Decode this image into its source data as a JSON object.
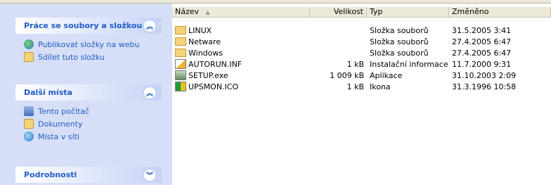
{
  "task_pane": {
    "sections": [
      {
        "title": "Práce se soubory a složkou",
        "toggle": "⌃",
        "items": [
          {
            "label": "Publikovat složky na webu",
            "icon": "globe-icon"
          },
          {
            "label": "Sdílet tuto složku",
            "icon": "share-folder-icon"
          }
        ]
      },
      {
        "title": "Další místa",
        "toggle": "⌃",
        "items": [
          {
            "label": "Tento počítač",
            "icon": "computer-icon"
          },
          {
            "label": "Dokumenty",
            "icon": "documents-folder-icon"
          },
          {
            "label": "Místa v síti",
            "icon": "network-places-icon"
          }
        ]
      },
      {
        "title": "Podrobnosti",
        "toggle": "⌄",
        "items": []
      }
    ]
  },
  "columns": {
    "name": "Název",
    "size": "Velikost",
    "type": "Typ",
    "modified": "Změněno",
    "sort_indicator": "▲"
  },
  "files": [
    {
      "name": "LINUX",
      "size": "",
      "type": "Složka souborů",
      "modified": "31.5.2005 3:41",
      "icon": "folder-icon"
    },
    {
      "name": "Netware",
      "size": "",
      "type": "Složka souborů",
      "modified": "27.4.2005 6:47",
      "icon": "folder-icon"
    },
    {
      "name": "Windows",
      "size": "",
      "type": "Složka souborů",
      "modified": "27.4.2005 6:47",
      "icon": "folder-icon"
    },
    {
      "name": "AUTORUN.INF",
      "size": "1 kB",
      "type": "Instalační informace",
      "modified": "11.7.2000 9:31",
      "icon": "setup-info-icon"
    },
    {
      "name": "SETUP.exe",
      "size": "1 009 kB",
      "type": "Aplikace",
      "modified": "31.10.2003 2:09",
      "icon": "setup-exe-icon"
    },
    {
      "name": "UPSMON.ICO",
      "size": "1 kB",
      "type": "Ikona",
      "modified": "31.3.1996 10:58",
      "icon": "icon-file-icon"
    }
  ],
  "colors": {
    "panel_title": "#215dc6",
    "pane_bg": "#d6dff7",
    "header_bg": "#ece9d8"
  }
}
